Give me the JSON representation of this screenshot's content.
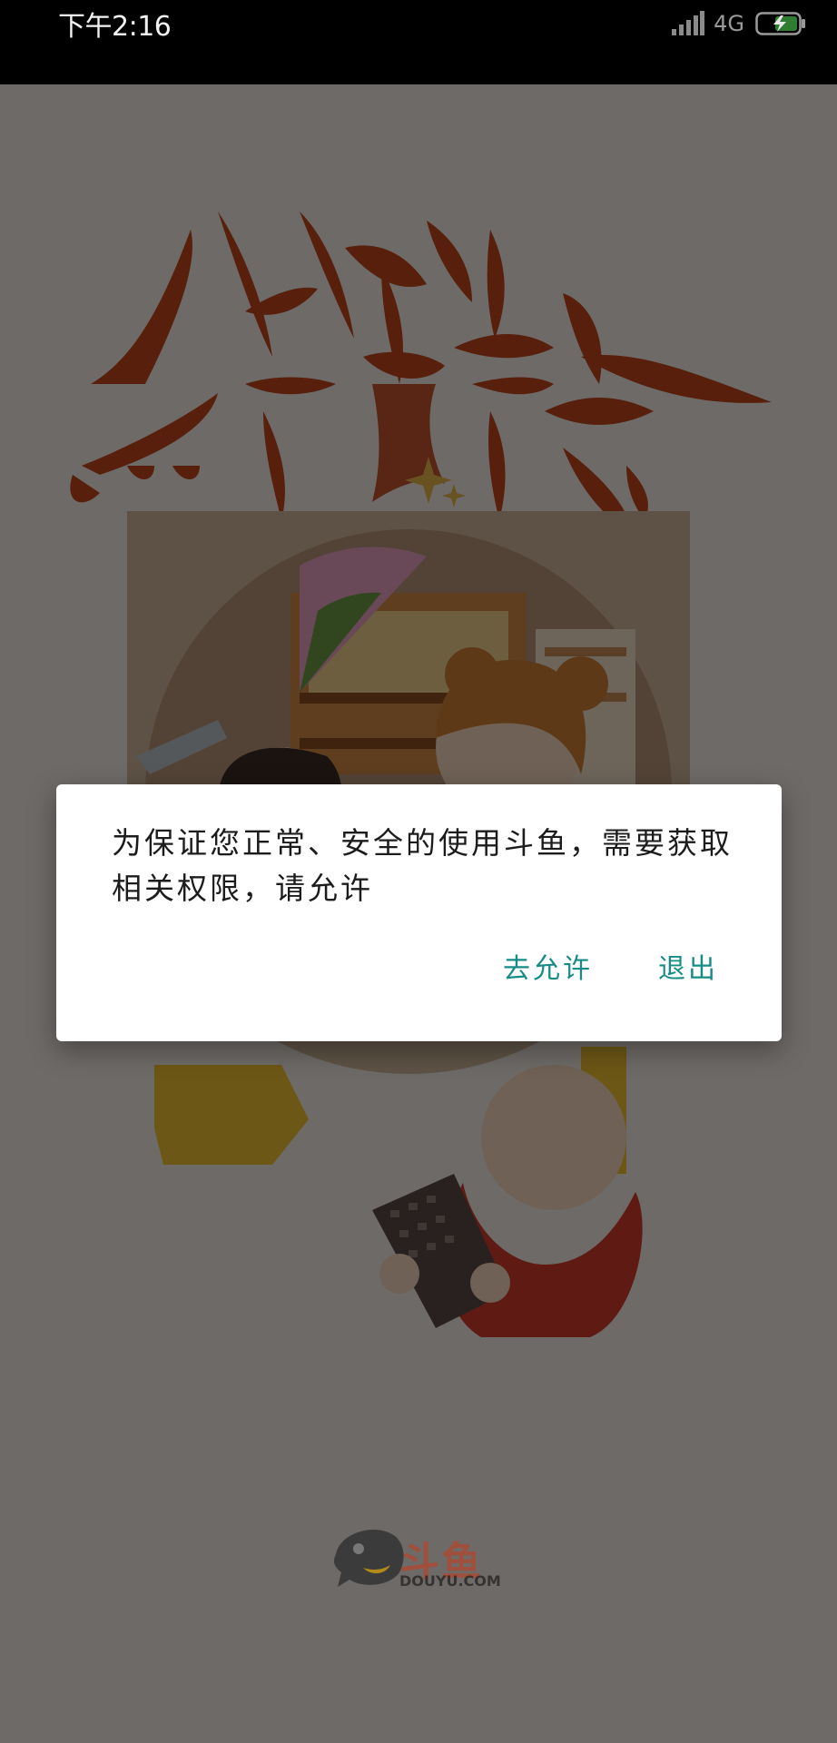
{
  "status_bar": {
    "time": "下午2:16",
    "network": "4G",
    "signal_icon": "signal-bars-icon",
    "battery_icon": "battery-charging-icon"
  },
  "splash": {
    "slogan_icon": "slogan-calligraphy-art",
    "illustration_icon": "gamers-illustration",
    "logo": {
      "icon": "douyu-fish-logo",
      "text": "斗鱼",
      "sub": "DOUYU.COM"
    }
  },
  "dialog": {
    "message": "为保证您正常、安全的使用斗鱼，需要获取相关权限，请允许",
    "allow_label": "去允许",
    "exit_label": "退出",
    "accent_color": "#178c86"
  }
}
